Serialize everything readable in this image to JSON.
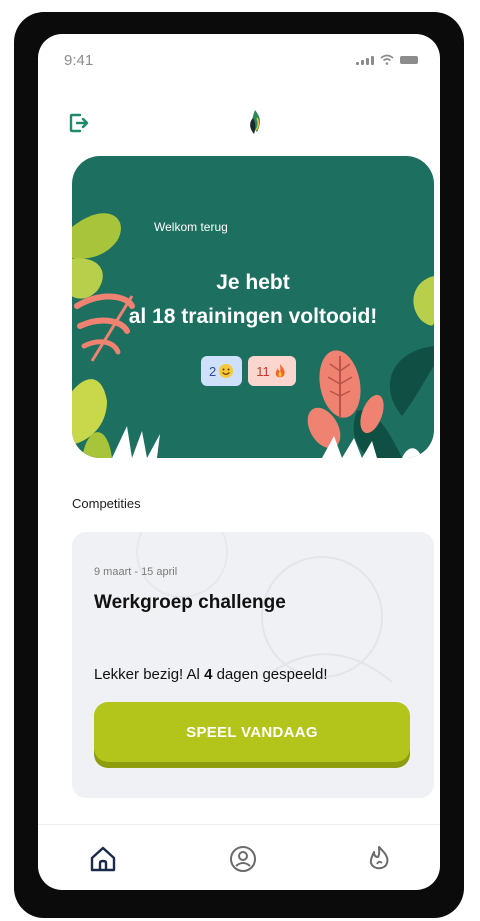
{
  "status_bar": {
    "time": "9:41"
  },
  "header": {
    "logout_icon": "logout-icon",
    "logo_icon": "leaf-flame-logo"
  },
  "hero": {
    "welcome": "Welkom terug",
    "headline_line1": "Je hebt",
    "headline_line2": "al 18 trainingen voltooid!",
    "badges": [
      {
        "value": "2",
        "icon": "smile-emoji-icon",
        "color": "#cfe0fb"
      },
      {
        "value": "11",
        "icon": "fire-emoji-icon",
        "color": "#fbd6cf"
      }
    ],
    "background_color": "#1d6f5f"
  },
  "competitions": {
    "section_title": "Competities",
    "card": {
      "date_range": "9 maart - 15 april",
      "title": "Werkgroep challenge",
      "progress_prefix": "Lekker bezig! Al ",
      "progress_days": "4",
      "progress_suffix": " dagen gespeeld!",
      "button_label": "SPEEL VANDAAG",
      "button_color": "#b3c41a"
    }
  },
  "bottom_nav": {
    "items": [
      {
        "name": "home",
        "icon": "home-icon"
      },
      {
        "name": "profile",
        "icon": "profile-icon"
      },
      {
        "name": "streak",
        "icon": "streak-icon"
      }
    ]
  }
}
